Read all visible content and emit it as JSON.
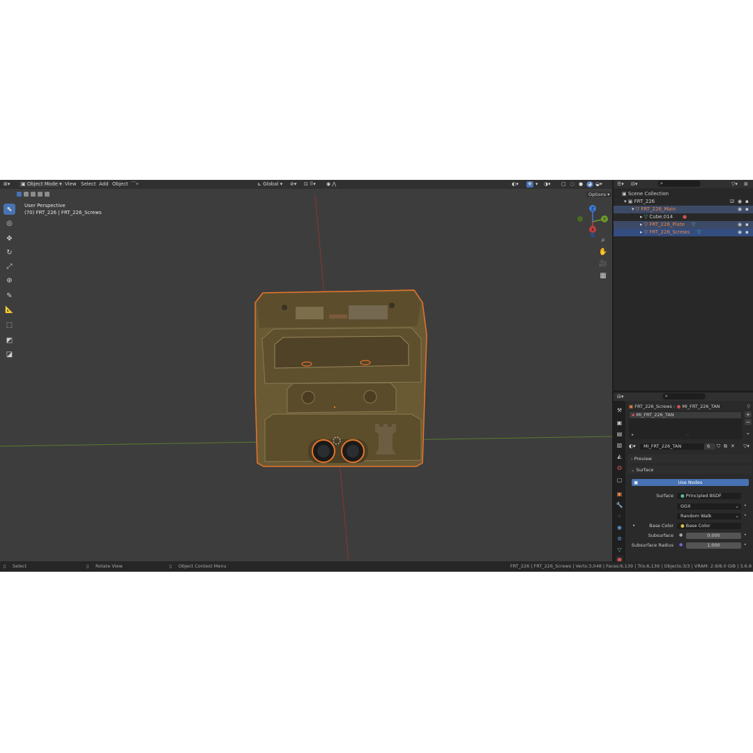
{
  "viewport_header": {
    "mode": "Object Mode",
    "menus": [
      "View",
      "Select",
      "Add",
      "Object"
    ],
    "transform_orientation": "Global",
    "options_label": "Options"
  },
  "viewport_overlay": {
    "view_name": "User Perspective",
    "object_info": "(70) FRT_226 | FRT_226_Screws"
  },
  "gizmo": {
    "z": "Z",
    "y": "Y",
    "x": "X"
  },
  "outliner": {
    "scene_collection": "Scene Collection",
    "items": [
      {
        "label": "FRT_226",
        "color": "#cfcfcf"
      },
      {
        "label": "FRT_226_Main",
        "color": "#e8884a"
      },
      {
        "label": "Cube.014",
        "color": "#d0d0d0"
      },
      {
        "label": "FRT_226_Plate",
        "color": "#e8884a"
      },
      {
        "label": "FRT_226_Screws",
        "color": "#e8884a"
      }
    ]
  },
  "properties": {
    "breadcrumb_object": "FRT_226_Screws",
    "breadcrumb_material": "MI_FRT_226_TAN",
    "slot_name": "MI_FRT_226_TAN",
    "material_name": "MI_FRT_226_TAN",
    "user_count": "6",
    "preview_label": "Preview",
    "surface_panel_label": "Surface",
    "use_nodes_label": "Use Nodes",
    "surface_label": "Surface",
    "surface_value": "Principled BSDF",
    "distribution": "GGX",
    "subsurface_method": "Random Walk",
    "base_color_label": "Base Color",
    "base_color_value": "Base Color",
    "subsurface_label": "Subsurface",
    "subsurface_value": "0.000",
    "subsurface_radius_label": "Subsurface Radius",
    "subsurface_radius_value": "1.000"
  },
  "status_bar": {
    "select": "Select",
    "rotate": "Rotate View",
    "context_menu": "Object Context Menu",
    "stats": "FRT_226 | FRT_226_Screws | Verts:3,048 | Faces:6,139 | Tris:6,139 | Objects:3/3 | VRAM: 2.9/8.0 GiB | 3.6.8"
  },
  "colors": {
    "accent": "#4772b3",
    "selection_outline": "#e8742a",
    "x_axis": "#c24040",
    "y_axis": "#6e9a2a",
    "z_axis": "#3d7ad6"
  }
}
